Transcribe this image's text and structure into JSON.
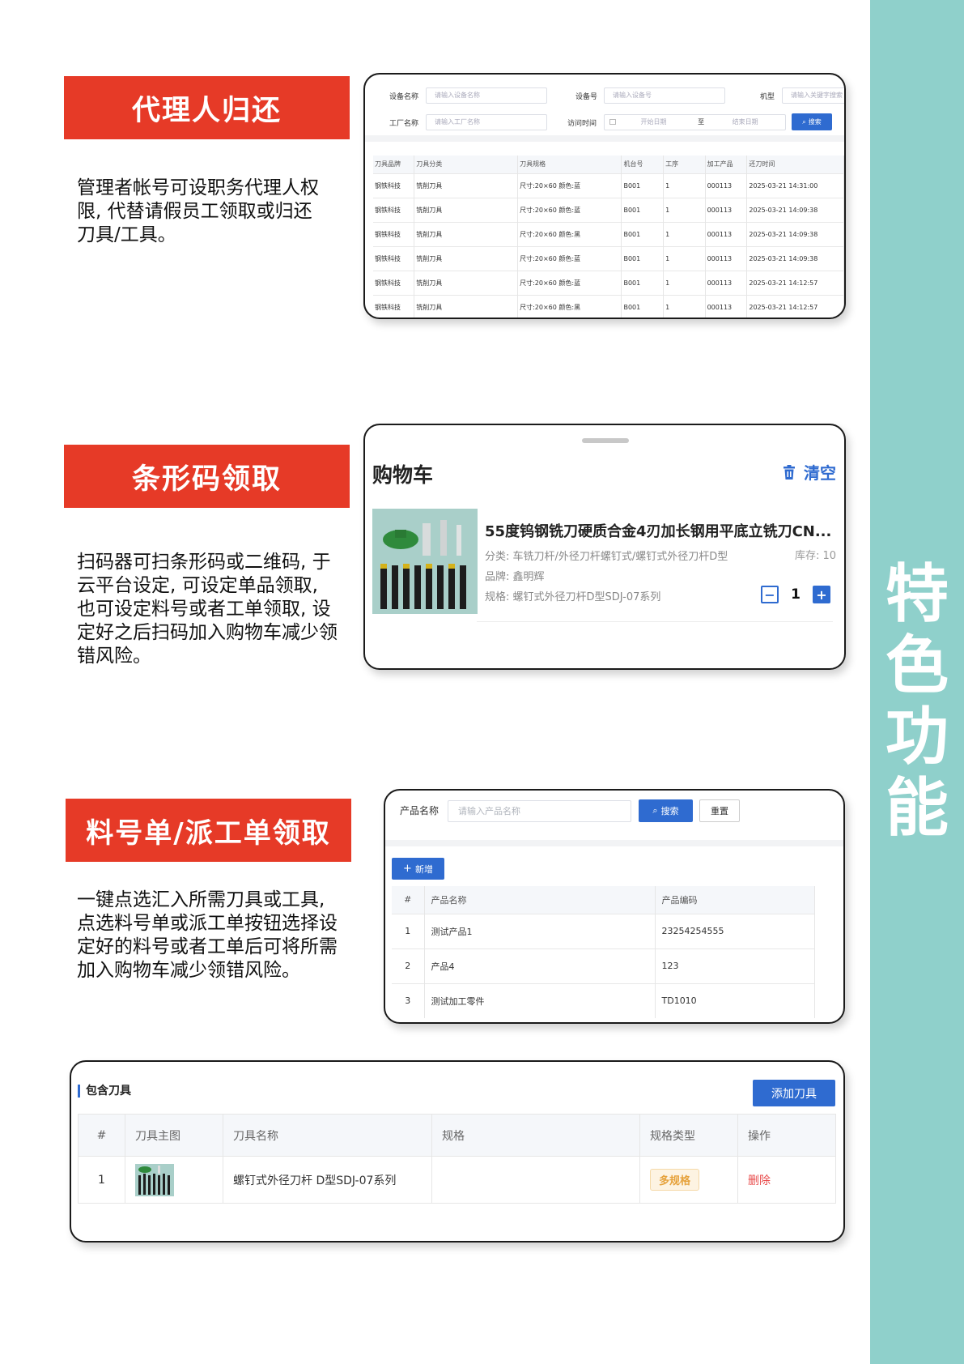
{
  "sidebar": {
    "chars": [
      "特",
      "色",
      "功",
      "能"
    ]
  },
  "sections": {
    "proxy": {
      "banner": "代理人归还",
      "desc_lines": [
        "管理者帐号可设职务代理人权",
        "限, 代替请假员工领取或归还",
        "刀具/工具。"
      ]
    },
    "barcode": {
      "banner": "条形码领取",
      "desc_lines": [
        "扫码器可扫条形码或二维码, 于",
        "云平台设定, 可设定单品领取,",
        "也可设定料号或者工单领取, 设",
        "定好之后扫码加入购物车减少领",
        "错风险。"
      ]
    },
    "workorder": {
      "banner": "料号单/派工单领取",
      "desc_lines": [
        "一键点选汇入所需刀具或工具,",
        "点选料号单或派工单按钮选择设",
        "定好的料号或者工单后可将所需",
        "加入购物车减少领错风险。"
      ]
    }
  },
  "card1": {
    "filters": {
      "device_name_label": "设备名称",
      "device_name_ph": "请输入设备名称",
      "device_no_label": "设备号",
      "device_no_ph": "请输入设备号",
      "model_label": "机型",
      "model_ph": "请输入关键字搜索",
      "factory_label": "工厂名称",
      "factory_ph": "请输入工厂名称",
      "time_label": "访问时间",
      "start_ph": "开始日期",
      "to": "至",
      "end_ph": "结束日期",
      "search": "搜索"
    },
    "columns": [
      "刀具品牌",
      "刀具分类",
      "刀具规格",
      "机台号",
      "工序",
      "加工产品",
      "还刀时间"
    ],
    "rows": [
      [
        "钢铁科技",
        "铣削刀具",
        "尺寸:20×60 颜色:蓝",
        "B001",
        "1",
        "000113",
        "2025-03-21 14:31:00"
      ],
      [
        "钢铁科技",
        "铣削刀具",
        "尺寸:20×60 颜色:蓝",
        "B001",
        "1",
        "000113",
        "2025-03-21 14:09:38"
      ],
      [
        "钢铁科技",
        "铣削刀具",
        "尺寸:20×60 颜色:黑",
        "B001",
        "1",
        "000113",
        "2025-03-21 14:09:38"
      ],
      [
        "钢铁科技",
        "铣削刀具",
        "尺寸:20×60 颜色:蓝",
        "B001",
        "1",
        "000113",
        "2025-03-21 14:09:38"
      ],
      [
        "钢铁科技",
        "铣削刀具",
        "尺寸:20×60 颜色:蓝",
        "B001",
        "1",
        "000113",
        "2025-03-21 14:12:57"
      ],
      [
        "钢铁科技",
        "铣削刀具",
        "尺寸:20×60 颜色:黑",
        "B001",
        "1",
        "000113",
        "2025-03-21 14:12:57"
      ]
    ]
  },
  "card2": {
    "title": "购物车",
    "clear": "清空",
    "product": {
      "name": "55度钨钢铣刀硬质合金4刃加长钢用平底立铣刀CN...",
      "category": "分类: 车铣刀杆/外径刀杆螺钉式/螺钉式外径刀杆D型",
      "stock": "库存: 10",
      "brand": "品牌: 鑫明辉",
      "spec": "规格: 螺钉式外径刀杆D型SDJ-07系列",
      "qty": "1"
    }
  },
  "card3": {
    "label": "产品名称",
    "placeholder": "请输入产品名称",
    "search": "搜索",
    "reset": "重置",
    "add": "新增",
    "columns": [
      "#",
      "产品名称",
      "产品编码"
    ],
    "rows": [
      [
        "1",
        "测试产品1",
        "23254254555"
      ],
      [
        "2",
        "产品4",
        "123"
      ],
      [
        "3",
        "测试加工零件",
        "TD1010"
      ]
    ]
  },
  "card4": {
    "title": "包含刀具",
    "add": "添加刀具",
    "columns": [
      "#",
      "刀具主图",
      "刀具名称",
      "规格",
      "规格类型",
      "操作"
    ],
    "row": {
      "num": "1",
      "name": "螺钉式外径刀杆 D型SDJ-07系列",
      "spec": "",
      "type": "多规格",
      "action": "删除"
    }
  },
  "colors": {
    "banner_red": "#e63a27",
    "accent_blue": "#2f6bd0",
    "sidebar_teal": "#8fd0cb"
  }
}
